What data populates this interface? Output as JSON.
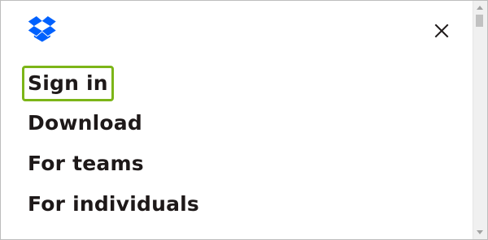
{
  "header": {
    "logo_icon": "dropbox-logo-icon",
    "close_icon": "close-icon",
    "brand_color": "#0061fe"
  },
  "menu": {
    "items": [
      {
        "label": "Sign in",
        "focused": true
      },
      {
        "label": "Download"
      },
      {
        "label": "For teams"
      },
      {
        "label": "For individuals"
      }
    ],
    "focus_ring_color": "#7cb518",
    "text_color": "#1e1919"
  }
}
